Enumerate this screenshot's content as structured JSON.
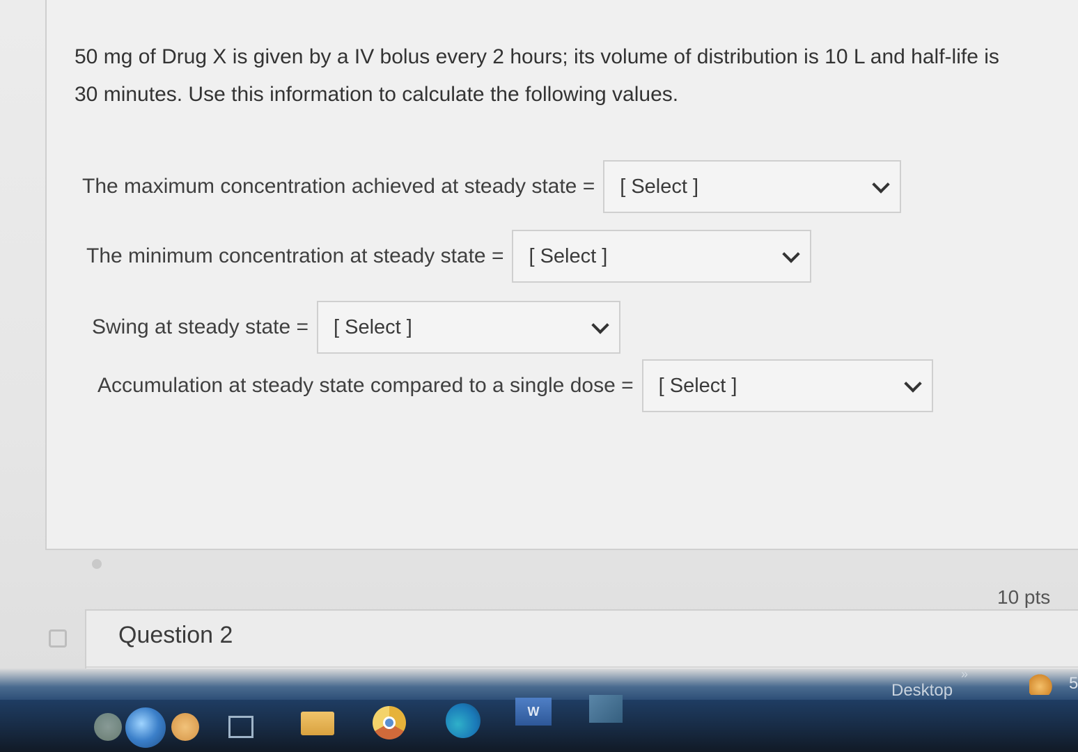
{
  "question": {
    "text": "50 mg of Drug X is given by a IV bolus every 2 hours; its volume of distribution is 10 L and half-life is\n30 minutes.  Use this information to calculate the following values.",
    "rows": [
      {
        "label": "The maximum concentration achieved at steady state =",
        "select": "[ Select ]"
      },
      {
        "label": "The minimum concentration at steady state =",
        "select": "[ Select ]"
      },
      {
        "label": "Swing at steady state =",
        "select": "[ Select ]"
      },
      {
        "label": "Accumulation at steady state compared to a single dose =",
        "select": "[ Select ]"
      }
    ]
  },
  "question2": {
    "title": "Question 2",
    "points": "10 pts"
  },
  "taskbar": {
    "desktop_label": "Desktop",
    "overflow_chevron": "»",
    "word_letter": "W",
    "tray_number": "5",
    "icons": [
      "orb-icon",
      "start-orb-icon",
      "task-view-icon",
      "folder-icon",
      "chrome-icon",
      "edge-icon",
      "word-icon",
      "photos-icon",
      "weather-icon"
    ]
  }
}
